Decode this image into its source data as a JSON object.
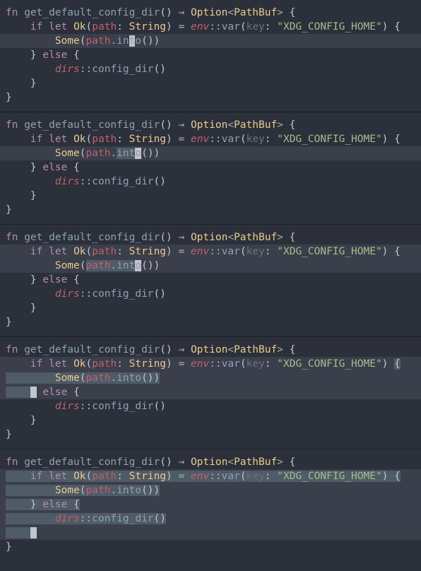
{
  "blocks": [
    {
      "lines": [
        {
          "indent": 0,
          "tokens": [
            "fn",
            " ",
            "get_default_config_dir",
            "()",
            " ",
            "→",
            " ",
            "Option",
            "<",
            "PathBuf",
            ">",
            " ",
            "{"
          ],
          "cls": [
            "kw",
            "",
            "fn",
            "paren",
            "",
            "arrow",
            "",
            "type2",
            "op",
            "type2",
            "op",
            "",
            "paren"
          ]
        },
        {
          "indent": 1,
          "hl": false,
          "tokens": [
            "if",
            " ",
            "let",
            " ",
            "Ok",
            "(",
            "path",
            ":",
            " ",
            "String",
            ")",
            " ",
            "=",
            " ",
            "env",
            "::",
            "var",
            "(",
            "key",
            ":",
            " ",
            "\"XDG_CONFIG_HOME\"",
            ")",
            " ",
            "{"
          ],
          "cls": [
            "kw",
            "",
            "kw",
            "",
            "type2",
            "paren",
            "var",
            "col",
            "",
            "type2",
            "paren",
            "",
            "op",
            "",
            "mod",
            "dblcol",
            "fn",
            "paren",
            "dim",
            "col",
            "",
            "str",
            "paren",
            "",
            "paren"
          ]
        },
        {
          "indent": 2,
          "hl": true,
          "tokens": [
            "Some",
            "(",
            "path",
            ".",
            "in",
            "t",
            "o",
            "()",
            ")"
          ],
          "cls": [
            "type2",
            "paren",
            "var",
            "op",
            "fn",
            "fn cursor",
            "fn",
            "paren",
            "paren"
          ]
        },
        {
          "indent": 1,
          "tokens": [
            "}",
            " ",
            "else",
            " ",
            "{"
          ],
          "cls": [
            "paren",
            "",
            "kw",
            "",
            "paren"
          ]
        },
        {
          "indent": 2,
          "tokens": [
            "dirs",
            "::",
            "config_dir",
            "()"
          ],
          "cls": [
            "mod",
            "dblcol",
            "fn",
            "paren"
          ]
        },
        {
          "indent": 1,
          "tokens": [
            "}"
          ],
          "cls": [
            "paren"
          ]
        },
        {
          "indent": 0,
          "tokens": [
            "}"
          ],
          "cls": [
            "paren"
          ]
        }
      ]
    },
    {
      "lines": [
        {
          "indent": 0,
          "tokens": [
            "fn",
            " ",
            "get_default_config_dir",
            "()",
            " ",
            "→",
            " ",
            "Option",
            "<",
            "PathBuf",
            ">",
            " ",
            "{"
          ],
          "cls": [
            "kw",
            "",
            "fn",
            "paren",
            "",
            "arrow",
            "",
            "type2",
            "op",
            "type2",
            "op",
            "",
            "paren"
          ]
        },
        {
          "indent": 1,
          "tokens": [
            "if",
            " ",
            "let",
            " ",
            "Ok",
            "(",
            "path",
            ":",
            " ",
            "String",
            ")",
            " ",
            "=",
            " ",
            "env",
            "::",
            "var",
            "(",
            "key",
            ":",
            " ",
            "\"XDG_CONFIG_HOME\"",
            ")",
            " ",
            "{"
          ],
          "cls": [
            "kw",
            "",
            "kw",
            "",
            "type2",
            "paren",
            "var",
            "col",
            "",
            "type2",
            "paren",
            "",
            "op",
            "",
            "mod",
            "dblcol",
            "fn",
            "paren",
            "dim",
            "col",
            "",
            "str",
            "paren",
            "",
            "paren"
          ]
        },
        {
          "indent": 2,
          "hl": true,
          "tokens": [
            "Some",
            "(",
            "path",
            ".",
            "int",
            "o",
            "()",
            ")"
          ],
          "cls": [
            "type2",
            "paren",
            "var",
            "op",
            "fn sel",
            "fn cursor",
            "paren",
            "paren"
          ]
        },
        {
          "indent": 1,
          "tokens": [
            "}",
            " ",
            "else",
            " ",
            "{"
          ],
          "cls": [
            "paren",
            "",
            "kw",
            "",
            "paren"
          ]
        },
        {
          "indent": 2,
          "tokens": [
            "dirs",
            "::",
            "config_dir",
            "()"
          ],
          "cls": [
            "mod",
            "dblcol",
            "fn",
            "paren"
          ]
        },
        {
          "indent": 1,
          "tokens": [
            "}"
          ],
          "cls": [
            "paren"
          ]
        },
        {
          "indent": 0,
          "tokens": [
            "}"
          ],
          "cls": [
            "paren"
          ]
        }
      ]
    },
    {
      "lines": [
        {
          "indent": 0,
          "tokens": [
            "fn",
            " ",
            "get_default_config_dir",
            "()",
            " ",
            "→",
            " ",
            "Option",
            "<",
            "PathBuf",
            ">",
            " ",
            "{"
          ],
          "cls": [
            "kw",
            "",
            "fn",
            "paren",
            "",
            "arrow",
            "",
            "type2",
            "op",
            "type2",
            "op",
            "",
            "paren"
          ]
        },
        {
          "indent": 1,
          "hl": true,
          "tokens": [
            "if",
            " ",
            "let",
            " ",
            "Ok",
            "(",
            "path",
            ":",
            " ",
            "String",
            ")",
            " ",
            "=",
            " ",
            "env",
            "::",
            "var",
            "(",
            "key",
            ":",
            " ",
            "\"XDG_CONFIG_HOME\"",
            ")",
            " ",
            "{"
          ],
          "cls": [
            "kw",
            "",
            "kw",
            "",
            "type2",
            "paren",
            "var",
            "col",
            "",
            "type2",
            "paren",
            "",
            "op",
            "",
            "mod",
            "dblcol",
            "fn",
            "paren",
            "dim",
            "col",
            "",
            "str",
            "paren",
            "",
            "paren"
          ]
        },
        {
          "indent": 2,
          "hl": true,
          "tokens": [
            "Some",
            "(",
            "path",
            ".",
            "int",
            "o",
            "()",
            ")"
          ],
          "cls": [
            "type2",
            "paren",
            "var sel",
            "op sel",
            "fn sel",
            "fn cursor",
            "paren",
            "paren"
          ]
        },
        {
          "indent": 1,
          "tokens": [
            "}",
            " ",
            "else",
            " ",
            "{"
          ],
          "cls": [
            "paren",
            "",
            "kw",
            "",
            "paren"
          ]
        },
        {
          "indent": 2,
          "tokens": [
            "dirs",
            "::",
            "config_dir",
            "()"
          ],
          "cls": [
            "mod",
            "dblcol",
            "fn",
            "paren"
          ]
        },
        {
          "indent": 1,
          "tokens": [
            "}"
          ],
          "cls": [
            "paren"
          ]
        },
        {
          "indent": 0,
          "tokens": [
            "}"
          ],
          "cls": [
            "paren"
          ]
        }
      ]
    },
    {
      "lines": [
        {
          "indent": 0,
          "tokens": [
            "fn",
            " ",
            "get_default_config_dir",
            "()",
            " ",
            "→",
            " ",
            "Option",
            "<",
            "PathBuf",
            ">",
            " ",
            "{"
          ],
          "cls": [
            "kw",
            "",
            "fn",
            "paren",
            "",
            "arrow",
            "",
            "type2",
            "op",
            "type2",
            "op",
            "",
            "paren"
          ]
        },
        {
          "indent": 1,
          "hl": true,
          "tokens": [
            "if",
            " ",
            "let",
            " ",
            "Ok",
            "(",
            "path",
            ":",
            " ",
            "String",
            ")",
            " ",
            "=",
            " ",
            "env",
            "::",
            "var",
            "(",
            "key",
            ":",
            " ",
            "\"XDG_CONFIG_HOME\"",
            ")",
            " ",
            "{"
          ],
          "cls": [
            "kw",
            "",
            "kw",
            "",
            "type2",
            "paren",
            "var",
            "col",
            "",
            "type2",
            "paren",
            "",
            "op",
            "",
            "mod",
            "dblcol",
            "fn",
            "paren",
            "dim",
            "col",
            "",
            "str",
            "paren",
            "",
            "paren sel"
          ],
          "selTrail": true
        },
        {
          "indent": 2,
          "hl": true,
          "selFull": true,
          "tokens": [
            "Some",
            "(",
            "path",
            ".",
            "into",
            "()",
            ")"
          ],
          "cls": [
            "type2",
            "paren",
            "var",
            "op",
            "fn",
            "paren",
            "paren"
          ]
        },
        {
          "indent": 1,
          "hl": true,
          "tokens": [
            "}",
            " ",
            "else",
            " ",
            "{"
          ],
          "cls": [
            "paren cursor",
            "",
            "kw",
            "",
            "paren"
          ],
          "selLead": true
        },
        {
          "indent": 2,
          "tokens": [
            "dirs",
            "::",
            "config_dir",
            "()"
          ],
          "cls": [
            "mod",
            "dblcol",
            "fn",
            "paren"
          ]
        },
        {
          "indent": 1,
          "tokens": [
            "}"
          ],
          "cls": [
            "paren"
          ]
        },
        {
          "indent": 0,
          "tokens": [
            "}"
          ],
          "cls": [
            "paren"
          ]
        }
      ]
    },
    {
      "lines": [
        {
          "indent": 0,
          "tokens": [
            "fn",
            " ",
            "get_default_config_dir",
            "()",
            " ",
            "→",
            " ",
            "Option",
            "<",
            "PathBuf",
            ">",
            " ",
            "{"
          ],
          "cls": [
            "kw",
            "",
            "fn",
            "paren",
            "",
            "arrow",
            "",
            "type2",
            "op",
            "type2",
            "op",
            "",
            "paren"
          ]
        },
        {
          "indent": 1,
          "hl": true,
          "selFullFrom": 1,
          "tokens": [
            "if",
            " ",
            "let",
            " ",
            "Ok",
            "(",
            "path",
            ":",
            " ",
            "String",
            ")",
            " ",
            "=",
            " ",
            "env",
            "::",
            "var",
            "(",
            "key",
            ":",
            " ",
            "\"XDG_CONFIG_HOME\"",
            ")",
            " ",
            "{"
          ],
          "cls": [
            "kw",
            "",
            "kw",
            "",
            "type2",
            "paren",
            "var",
            "col",
            "",
            "type2",
            "paren",
            "",
            "op",
            "",
            "mod",
            "dblcol",
            "fn",
            "paren",
            "dim",
            "col",
            "",
            "str",
            "paren",
            "",
            "paren"
          ],
          "selAll": true
        },
        {
          "indent": 2,
          "hl": true,
          "selFull": true,
          "tokens": [
            "Some",
            "(",
            "path",
            ".",
            "into",
            "()",
            ")"
          ],
          "cls": [
            "type2",
            "paren",
            "var",
            "op",
            "fn",
            "paren",
            "paren"
          ]
        },
        {
          "indent": 1,
          "hl": true,
          "selFull": true,
          "tokens": [
            "}",
            " ",
            "else",
            " ",
            "{"
          ],
          "cls": [
            "paren",
            "",
            "kw",
            "",
            "paren"
          ]
        },
        {
          "indent": 2,
          "hl": true,
          "selFull": true,
          "tokens": [
            "dirs",
            "::",
            "config_dir",
            "()"
          ],
          "cls": [
            "mod",
            "dblcol",
            "fn",
            "paren"
          ]
        },
        {
          "indent": 1,
          "hl": true,
          "tokens": [
            "}"
          ],
          "cls": [
            "paren cursor"
          ],
          "selLead": true
        },
        {
          "indent": 0,
          "tokens": [
            "}"
          ],
          "cls": [
            "paren"
          ]
        }
      ]
    }
  ]
}
